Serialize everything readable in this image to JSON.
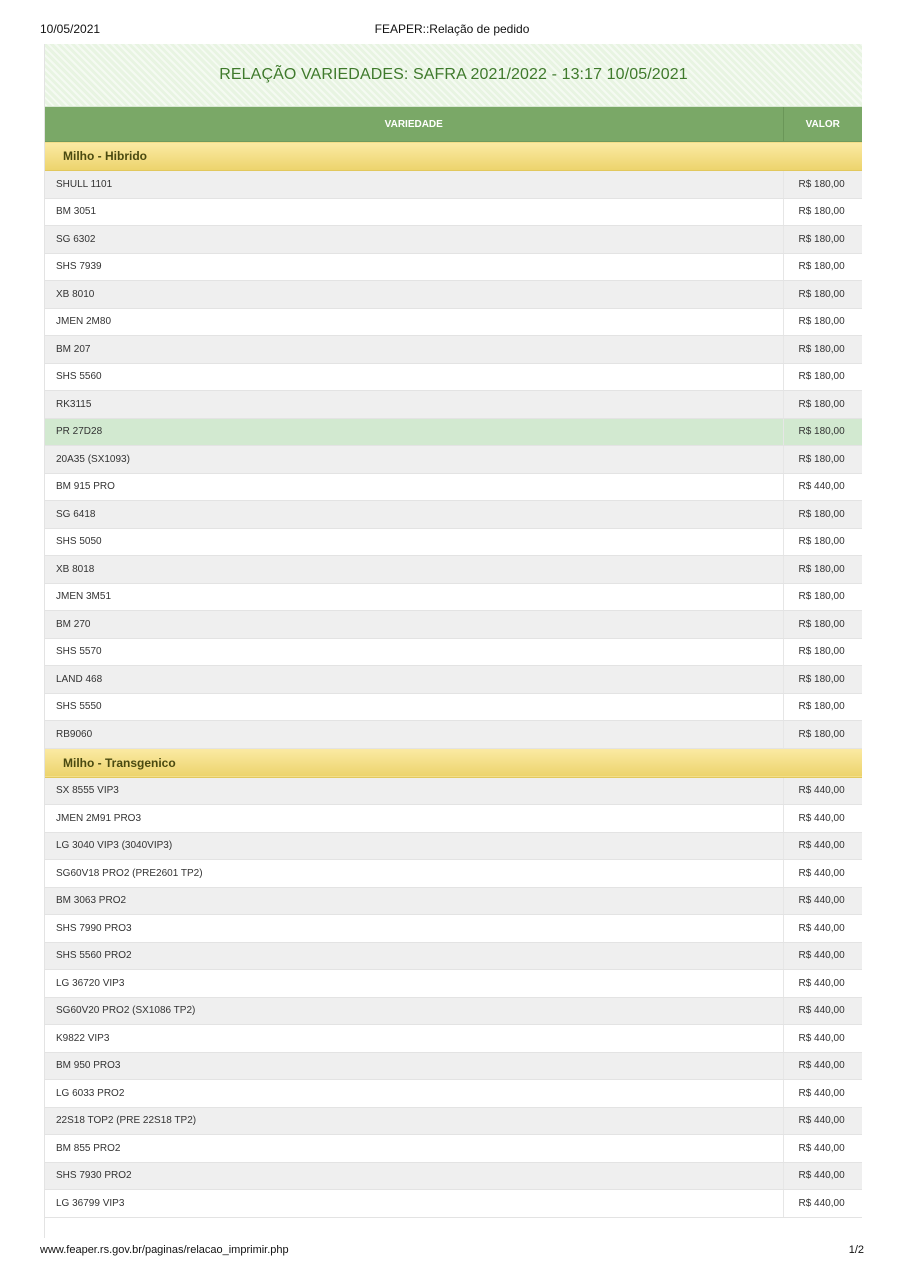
{
  "print_header": {
    "date": "10/05/2021",
    "title": "FEAPER::Relação de pedido"
  },
  "banner": {
    "title": "RELAÇÃO VARIEDADES: SAFRA 2021/2022 - 13:17 10/05/2021"
  },
  "table": {
    "headers": {
      "variety": "VARIEDADE",
      "value": "VALOR"
    },
    "groups": [
      {
        "name": "Milho - Hibrido",
        "rows": [
          {
            "variety": "SHULL 1101",
            "value": "R$ 180,00"
          },
          {
            "variety": "BM 3051",
            "value": "R$ 180,00"
          },
          {
            "variety": "SG 6302",
            "value": "R$ 180,00"
          },
          {
            "variety": "SHS 7939",
            "value": "R$ 180,00"
          },
          {
            "variety": "XB 8010",
            "value": "R$ 180,00"
          },
          {
            "variety": "JMEN 2M80",
            "value": "R$ 180,00"
          },
          {
            "variety": "BM 207",
            "value": "R$ 180,00"
          },
          {
            "variety": "SHS 5560",
            "value": "R$ 180,00"
          },
          {
            "variety": "RK3115",
            "value": "R$ 180,00"
          },
          {
            "variety": "PR 27D28",
            "value": "R$ 180,00",
            "highlight": true
          },
          {
            "variety": "20A35 (SX1093)",
            "value": "R$ 180,00"
          },
          {
            "variety": "BM 915 PRO",
            "value": "R$ 440,00"
          },
          {
            "variety": "SG 6418",
            "value": "R$ 180,00"
          },
          {
            "variety": "SHS 5050",
            "value": "R$ 180,00"
          },
          {
            "variety": "XB 8018",
            "value": "R$ 180,00"
          },
          {
            "variety": "JMEN 3M51",
            "value": "R$ 180,00"
          },
          {
            "variety": "BM 270",
            "value": "R$ 180,00"
          },
          {
            "variety": "SHS 5570",
            "value": "R$ 180,00"
          },
          {
            "variety": "LAND 468",
            "value": "R$ 180,00"
          },
          {
            "variety": "SHS 5550",
            "value": "R$ 180,00"
          },
          {
            "variety": "RB9060",
            "value": "R$ 180,00"
          }
        ]
      },
      {
        "name": "Milho - Transgenico",
        "rows": [
          {
            "variety": "SX 8555 VIP3",
            "value": "R$ 440,00"
          },
          {
            "variety": "JMEN 2M91 PRO3",
            "value": "R$ 440,00"
          },
          {
            "variety": "LG 3040 VIP3 (3040VIP3)",
            "value": "R$ 440,00"
          },
          {
            "variety": "SG60V18 PRO2 (PRE2601 TP2)",
            "value": "R$ 440,00"
          },
          {
            "variety": "BM 3063 PRO2",
            "value": "R$ 440,00"
          },
          {
            "variety": "SHS 7990 PRO3",
            "value": "R$ 440,00"
          },
          {
            "variety": "SHS 5560 PRO2",
            "value": "R$ 440,00"
          },
          {
            "variety": "LG 36720 VIP3",
            "value": "R$ 440,00"
          },
          {
            "variety": "SG60V20 PRO2 (SX1086 TP2)",
            "value": "R$ 440,00"
          },
          {
            "variety": "K9822 VIP3",
            "value": "R$ 440,00"
          },
          {
            "variety": "BM 950 PRO3",
            "value": "R$ 440,00"
          },
          {
            "variety": "LG 6033 PRO2",
            "value": "R$ 440,00"
          },
          {
            "variety": "22S18 TOP2 (PRE 22S18 TP2)",
            "value": "R$ 440,00"
          },
          {
            "variety": "BM 855 PRO2",
            "value": "R$ 440,00"
          },
          {
            "variety": "SHS 7930 PRO2",
            "value": "R$ 440,00"
          },
          {
            "variety": "LG 36799 VIP3",
            "value": "R$ 440,00"
          }
        ]
      }
    ]
  },
  "print_footer": {
    "url": "www.feaper.rs.gov.br/paginas/relacao_imprimir.php",
    "page": "1/2"
  }
}
